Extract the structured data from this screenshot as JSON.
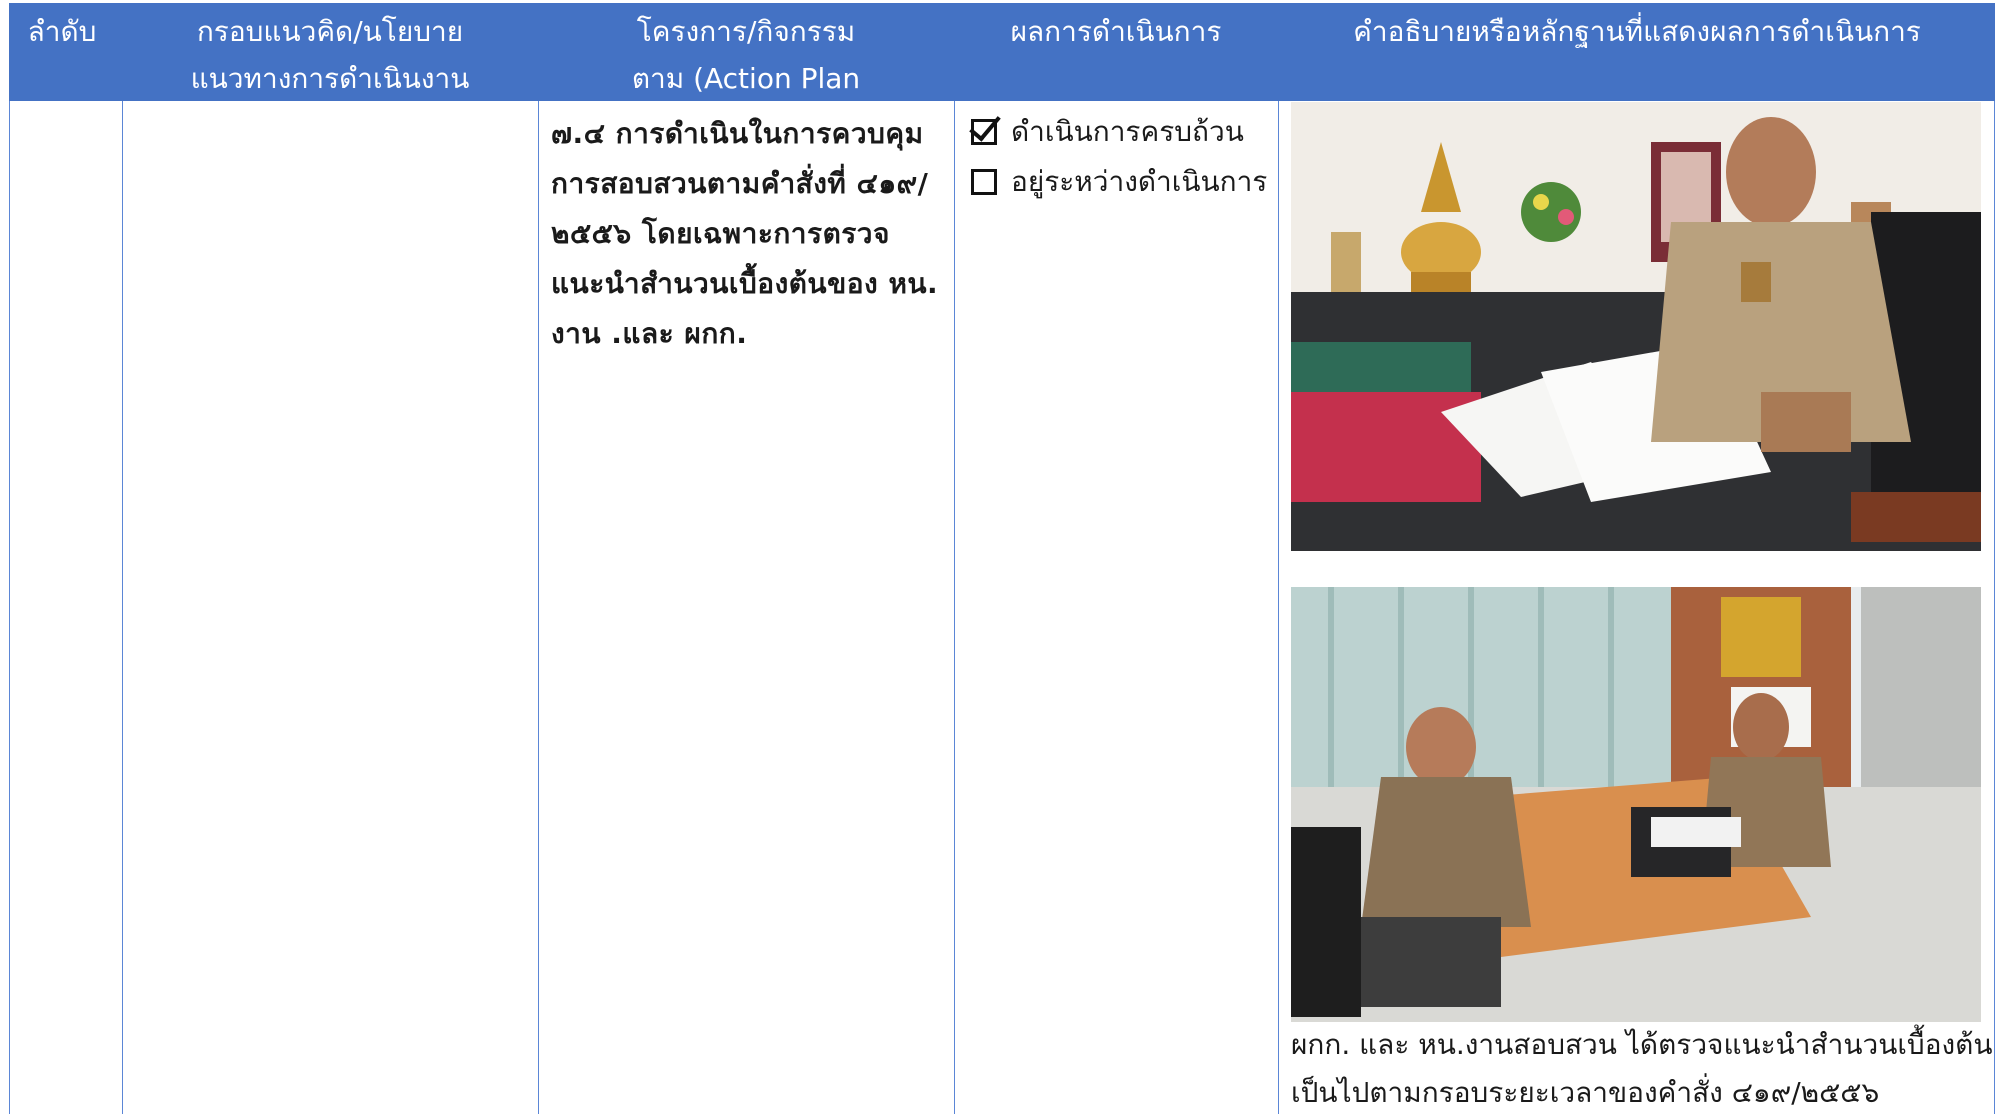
{
  "table": {
    "header": {
      "col_order": "ลำดับ",
      "col_framework_line1": "กรอบแนวคิด/นโยบาย",
      "col_framework_line2": "แนวทางการดำเนินงาน",
      "col_project_line1": "โครงการ/กิจกรรม",
      "col_project_line2": "ตาม (Action Plan",
      "col_result": "ผลการดำเนินการ",
      "col_evidence": "คำอธิบายหรือหลักฐานที่แสดงผลการดำเนินการ"
    },
    "project_lines": [
      "๗.๔  การดำเนินในการควบคุม",
      "การสอบสวนตามคำสั่งที่ ๔๑๙/",
      "๒๕๕๖ โดยเฉพาะการตรวจ",
      "แนะนำสำนวนเบื้องต้นของ หน.",
      "งาน .และ ผกก."
    ],
    "result_options": [
      {
        "label": "ดำเนินการครบถ้วน",
        "checked": true
      },
      {
        "label": "อยู่ระหว่างดำเนินการ",
        "checked": false
      }
    ],
    "evidence": {
      "photo1_desc": "police-officer-signing-documents-photo",
      "photo2_desc": "officers-reviewing-case-files-photo",
      "caption_line1": "ผกก. และ หน.งานสอบสวน ได้ตรวจแนะนำสำนวนเบื้องต้น",
      "caption_line2": "เป็นไปตามกรอบระยะเวลาของคำสั่ง ๔๑๙/๒๕๕๖"
    }
  },
  "colors": {
    "header_bg": "#4472c4",
    "header_text": "#ffffff",
    "grid_line": "#5b86d6"
  }
}
